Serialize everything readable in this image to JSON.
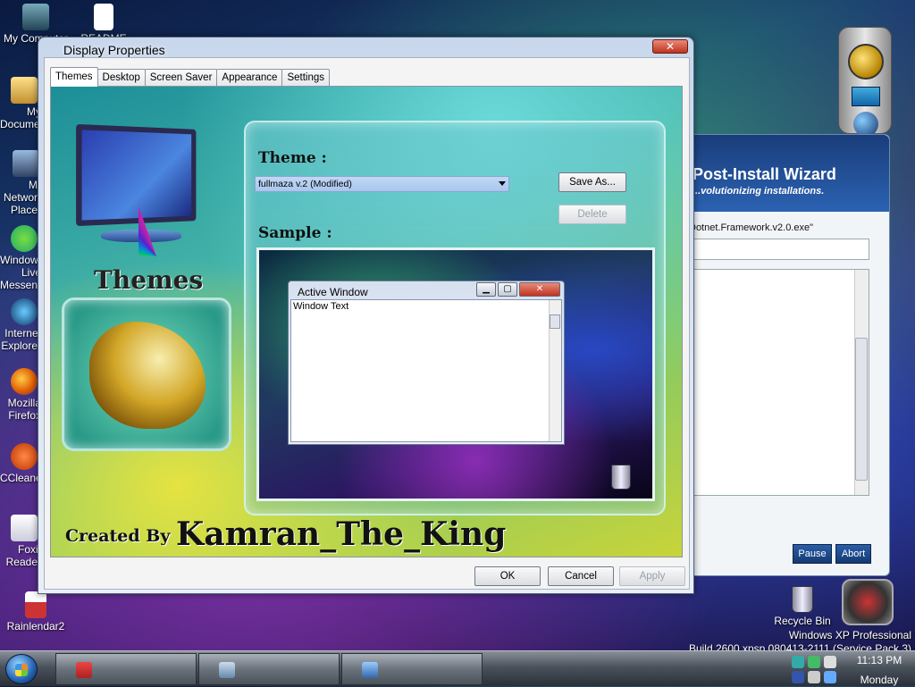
{
  "desktop": {
    "icons": [
      {
        "label": "My Computer"
      },
      {
        "label": "README"
      },
      {
        "label": "My Documents"
      },
      {
        "label": "My Network Places"
      },
      {
        "label": "Windows Live Messenger"
      },
      {
        "label": "Internet Explorer"
      },
      {
        "label": "Mozilla Firefox"
      },
      {
        "label": "CCleaner"
      },
      {
        "label": "Foxit Reader"
      },
      {
        "label": "Rainlendar2"
      },
      {
        "label": "Recycle Bin"
      }
    ],
    "watermark": {
      "line1": "Windows XP Professional",
      "line2": "Build 2600.xpsp.080413-2111 (Service Pack 3)"
    }
  },
  "wizard": {
    "title": "Post-Install Wizard",
    "subtitle": "...volutionizing installations.",
    "current_file": "Dotnet.Framework.v2.0.exe\"",
    "pause_label": "Pause",
    "abort_label": "Abort"
  },
  "display_properties": {
    "title": "Display Properties",
    "close_label": "✕",
    "tabs": [
      {
        "label": "Themes",
        "active": true
      },
      {
        "label": "Desktop",
        "active": false
      },
      {
        "label": "Screen Saver",
        "active": false
      },
      {
        "label": "Appearance",
        "active": false
      },
      {
        "label": "Settings",
        "active": false
      }
    ],
    "themes_pane": {
      "side_label": "Themes",
      "credit_prefix": "Created By",
      "credit_name": "Kamran_The_King",
      "theme_label": "Theme :",
      "theme_selected": "fullmaza v.2 (Modified)",
      "save_as_label": "Save As...",
      "delete_label": "Delete",
      "sample_label": "Sample :",
      "sample_window": {
        "title": "Active Window",
        "text": "Window Text",
        "min": "▁",
        "max": "▢",
        "close": "✕"
      }
    },
    "buttons": {
      "ok": "OK",
      "cancel": "Cancel",
      "apply": "Apply"
    }
  },
  "taskbar": {
    "clock_time": "11:13 PM",
    "clock_day": "Monday"
  },
  "colors": {
    "accent": "#2b62b2",
    "close_red": "#c0331d"
  }
}
